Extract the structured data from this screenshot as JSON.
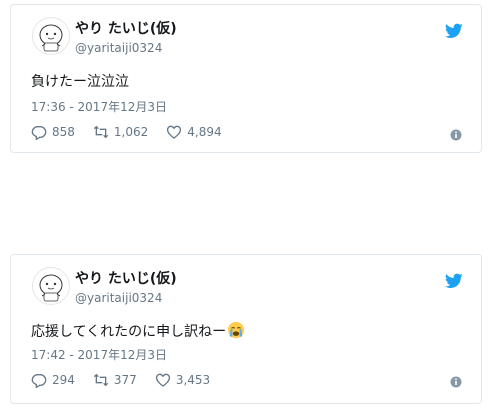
{
  "tweets": [
    {
      "display_name": "やり たいじ(仮)",
      "handle": "@yaritaiji0324",
      "text": "負けたー泣泣泣",
      "timestamp": "17:36 - 2017年12月3日",
      "replies": "858",
      "retweets": "1,062",
      "likes": "4,894",
      "emoji": ""
    },
    {
      "display_name": "やり たいじ(仮)",
      "handle": "@yaritaiji0324",
      "text": "応援してくれたのに申し訳ねー",
      "timestamp": "17:42 - 2017年12月3日",
      "replies": "294",
      "retweets": "377",
      "likes": "3,453",
      "emoji": "crying-face-icon"
    }
  ],
  "colors": {
    "twitter_blue": "#1da1f2",
    "secondary_text": "#657786",
    "border": "#e1e8ed"
  }
}
